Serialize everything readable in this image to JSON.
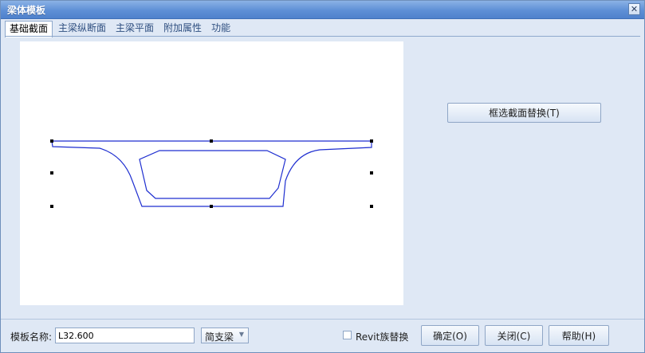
{
  "window": {
    "title": "梁体模板",
    "close_icon": "close-icon"
  },
  "tabs": [
    {
      "label": "基础截面",
      "active": true
    },
    {
      "label": "主梁纵断面",
      "active": false
    },
    {
      "label": "主梁平面",
      "active": false
    },
    {
      "label": "附加属性",
      "active": false
    },
    {
      "label": "功能",
      "active": false
    }
  ],
  "side_buttons": {
    "replace_label": "框选截面替换(T)"
  },
  "footer": {
    "name_label": "模板名称:",
    "name_value": "L32.600",
    "beam_type": "简支梁",
    "revit_replace_label": "Revit族替换",
    "revit_replace_checked": false,
    "ok_label": "确定(O)",
    "close_label": "关闭(C)",
    "help_label": "帮助(H)"
  },
  "colors": {
    "section_outline": "#1f2fd0",
    "title_bar": "#5e8fd6",
    "handle": "#000000"
  }
}
